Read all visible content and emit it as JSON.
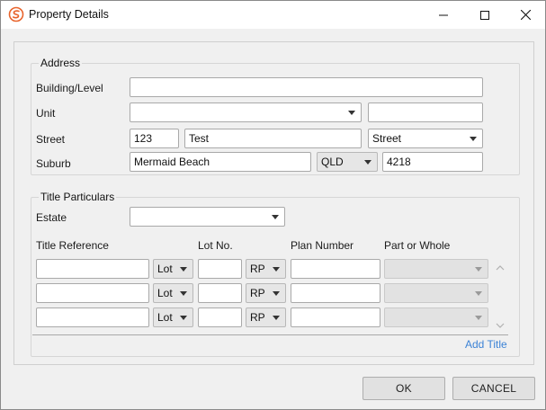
{
  "window": {
    "title": "Property Details"
  },
  "address": {
    "group_title": "Address",
    "building_label": "Building/Level",
    "building_value": "",
    "unit_label": "Unit",
    "unit_type_value": "",
    "unit_number_value": "",
    "street_label": "Street",
    "street_number": "123",
    "street_name": "Test",
    "street_type": "Street",
    "suburb_label": "Suburb",
    "suburb_value": "Mermaid Beach",
    "state_value": "QLD",
    "postcode_value": "4218"
  },
  "title_particulars": {
    "group_title": "Title Particulars",
    "estate_label": "Estate",
    "estate_value": "",
    "columns": [
      "Title Reference",
      "Lot No.",
      "Plan Number",
      "Part or Whole"
    ],
    "rows": [
      {
        "title_reference": "",
        "lot_type": "Lot",
        "lot_number": "",
        "plan_type": "RP",
        "plan_number": "",
        "part_or_whole": ""
      },
      {
        "title_reference": "",
        "lot_type": "Lot",
        "lot_number": "",
        "plan_type": "RP",
        "plan_number": "",
        "part_or_whole": ""
      },
      {
        "title_reference": "",
        "lot_type": "Lot",
        "lot_number": "",
        "plan_type": "RP",
        "plan_number": "",
        "part_or_whole": ""
      }
    ],
    "add_title_label": "Add Title"
  },
  "footer": {
    "ok_label": "OK",
    "cancel_label": "CANCEL"
  },
  "colors": {
    "app_icon": "#e8632b",
    "link": "#3c83d6"
  },
  "icons": [
    "app-logo-icon",
    "minimize-icon",
    "maximize-icon",
    "close-icon",
    "chevron-down-icon",
    "scroll-up-icon",
    "scroll-down-icon"
  ]
}
